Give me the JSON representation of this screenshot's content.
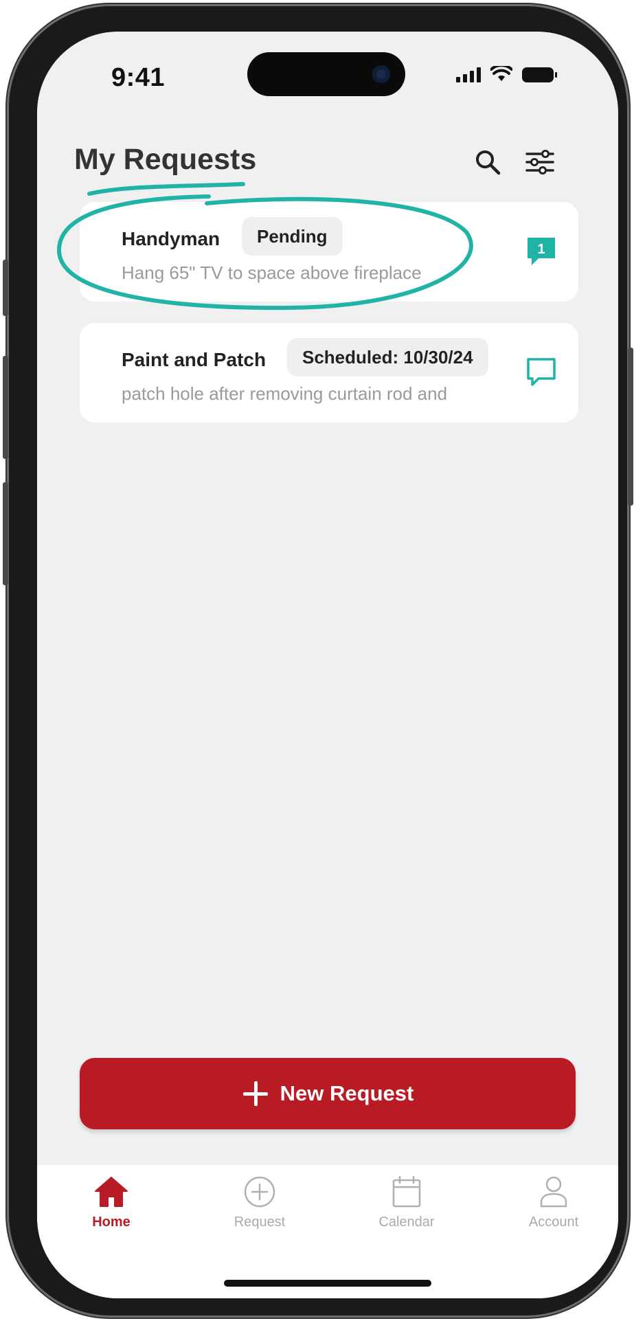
{
  "status_bar": {
    "time": "9:41"
  },
  "header": {
    "title": "My Requests"
  },
  "requests": [
    {
      "title": "Handyman",
      "status": "Pending",
      "description": "Hang 65\" TV to space above fireplace",
      "message_count": "1"
    },
    {
      "title": "Paint and Patch",
      "status": "Scheduled: 10/30/24",
      "description": "patch hole after removing curtain rod and",
      "message_count": ""
    }
  ],
  "new_request_button": {
    "label": "New Request"
  },
  "tabs": [
    {
      "label": "Home"
    },
    {
      "label": "Request"
    },
    {
      "label": "Calendar"
    },
    {
      "label": "Account"
    }
  ],
  "colors": {
    "brand_red": "#b81b24",
    "accent_teal": "#22b3a7",
    "background": "#f0f0f0"
  }
}
